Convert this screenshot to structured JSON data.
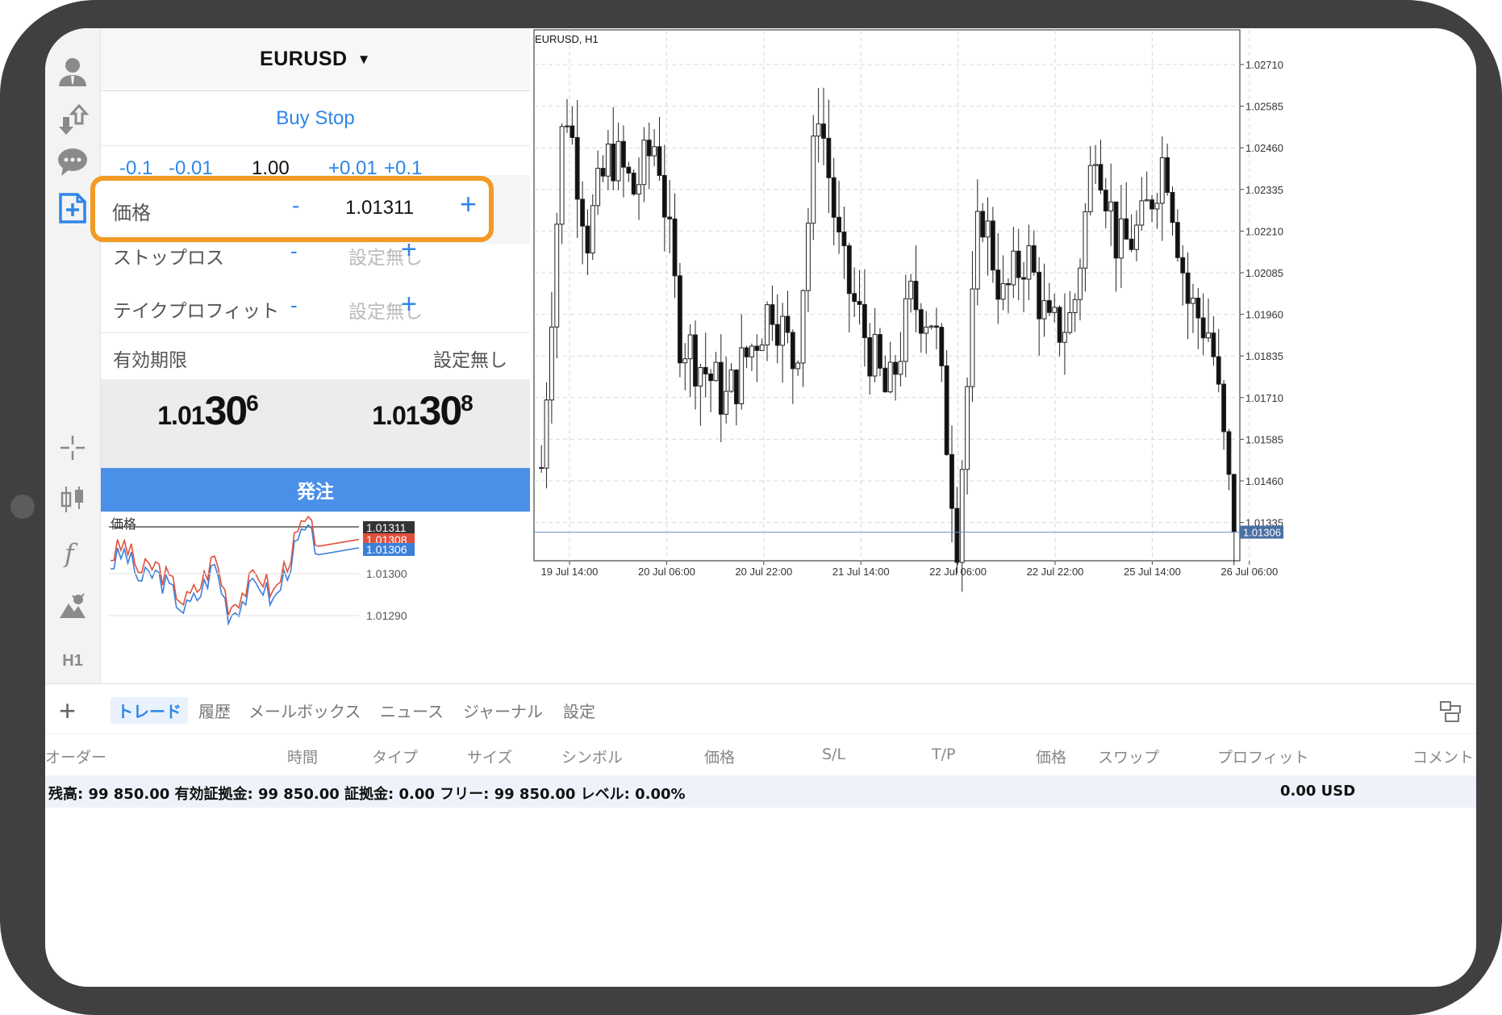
{
  "panel": {
    "symbol": "EURUSD",
    "symbol_caret": "▼",
    "order_type": "Buy Stop",
    "volume": {
      "minus_01": "-0.1",
      "minus_001": "-0.01",
      "value": "1.00",
      "plus_001": "+0.01",
      "plus_01": "+0.1"
    },
    "price_row": {
      "label": "価格",
      "minus": "-",
      "value": "1.01311",
      "plus": "+"
    },
    "stoploss_row": {
      "label": "ストップロス",
      "minus": "-",
      "value": "設定無し",
      "plus": "+"
    },
    "takeprofit_row": {
      "label": "テイクプロフィット",
      "minus": "-",
      "value": "設定無し",
      "plus": "+"
    },
    "expiry_row": {
      "label": "有効期限",
      "value": "設定無し"
    },
    "bid": {
      "small": "1.01",
      "large": "30",
      "sup": "6"
    },
    "ask": {
      "small": "1.01",
      "large": "30",
      "sup": "8"
    },
    "order_button": "発注",
    "mini_chart": {
      "label": "価格",
      "levels": [
        "1.01311",
        "1.01308",
        "1.01306"
      ],
      "level_colors": [
        "#333333",
        "#e0503c",
        "#3b7fd9"
      ],
      "axis": [
        "1.01300",
        "1.01290"
      ]
    }
  },
  "chart": {
    "symbol_label": "EURUSD, H1",
    "price_axis": [
      "1.02710",
      "1.02585",
      "1.02460",
      "1.02335",
      "1.02210",
      "1.02085",
      "1.01960",
      "1.01835",
      "1.01710",
      "1.01585",
      "1.01460",
      "1.01335"
    ],
    "current_price": "1.01306",
    "time_axis": [
      "19 Jul 14:00",
      "20 Jul 06:00",
      "20 Jul 22:00",
      "21 Jul 14:00",
      "22 Jul 06:00",
      "22 Jul 22:00",
      "25 Jul 14:00",
      "26 Jul 06:00"
    ]
  },
  "bottom": {
    "add_icon": "+",
    "tabs": [
      "トレード",
      "履歴",
      "メールボックス",
      "ニュース",
      "ジャーナル",
      "設定"
    ],
    "active_tab": 0,
    "columns": [
      "オーダー",
      "時間",
      "タイプ",
      "サイズ",
      "シンボル",
      "価格",
      "S/L",
      "T/P",
      "価格",
      "スワップ",
      "プロフィット",
      "コメント"
    ],
    "balance_text": "残高: 99 850.00 有効証拠金: 99 850.00 証拠金: 0.00 フリー: 99 850.00 レベル: 0.00%",
    "profit": "0.00  USD"
  },
  "toolbar_icons": [
    "account-icon",
    "trade-icon",
    "chat-icon",
    "new-order-icon",
    "crosshair-icon",
    "chart-type-icon",
    "indicator-icon",
    "objects-icon",
    "timeframe-icon"
  ],
  "toolbar_timeframe": "H1"
}
